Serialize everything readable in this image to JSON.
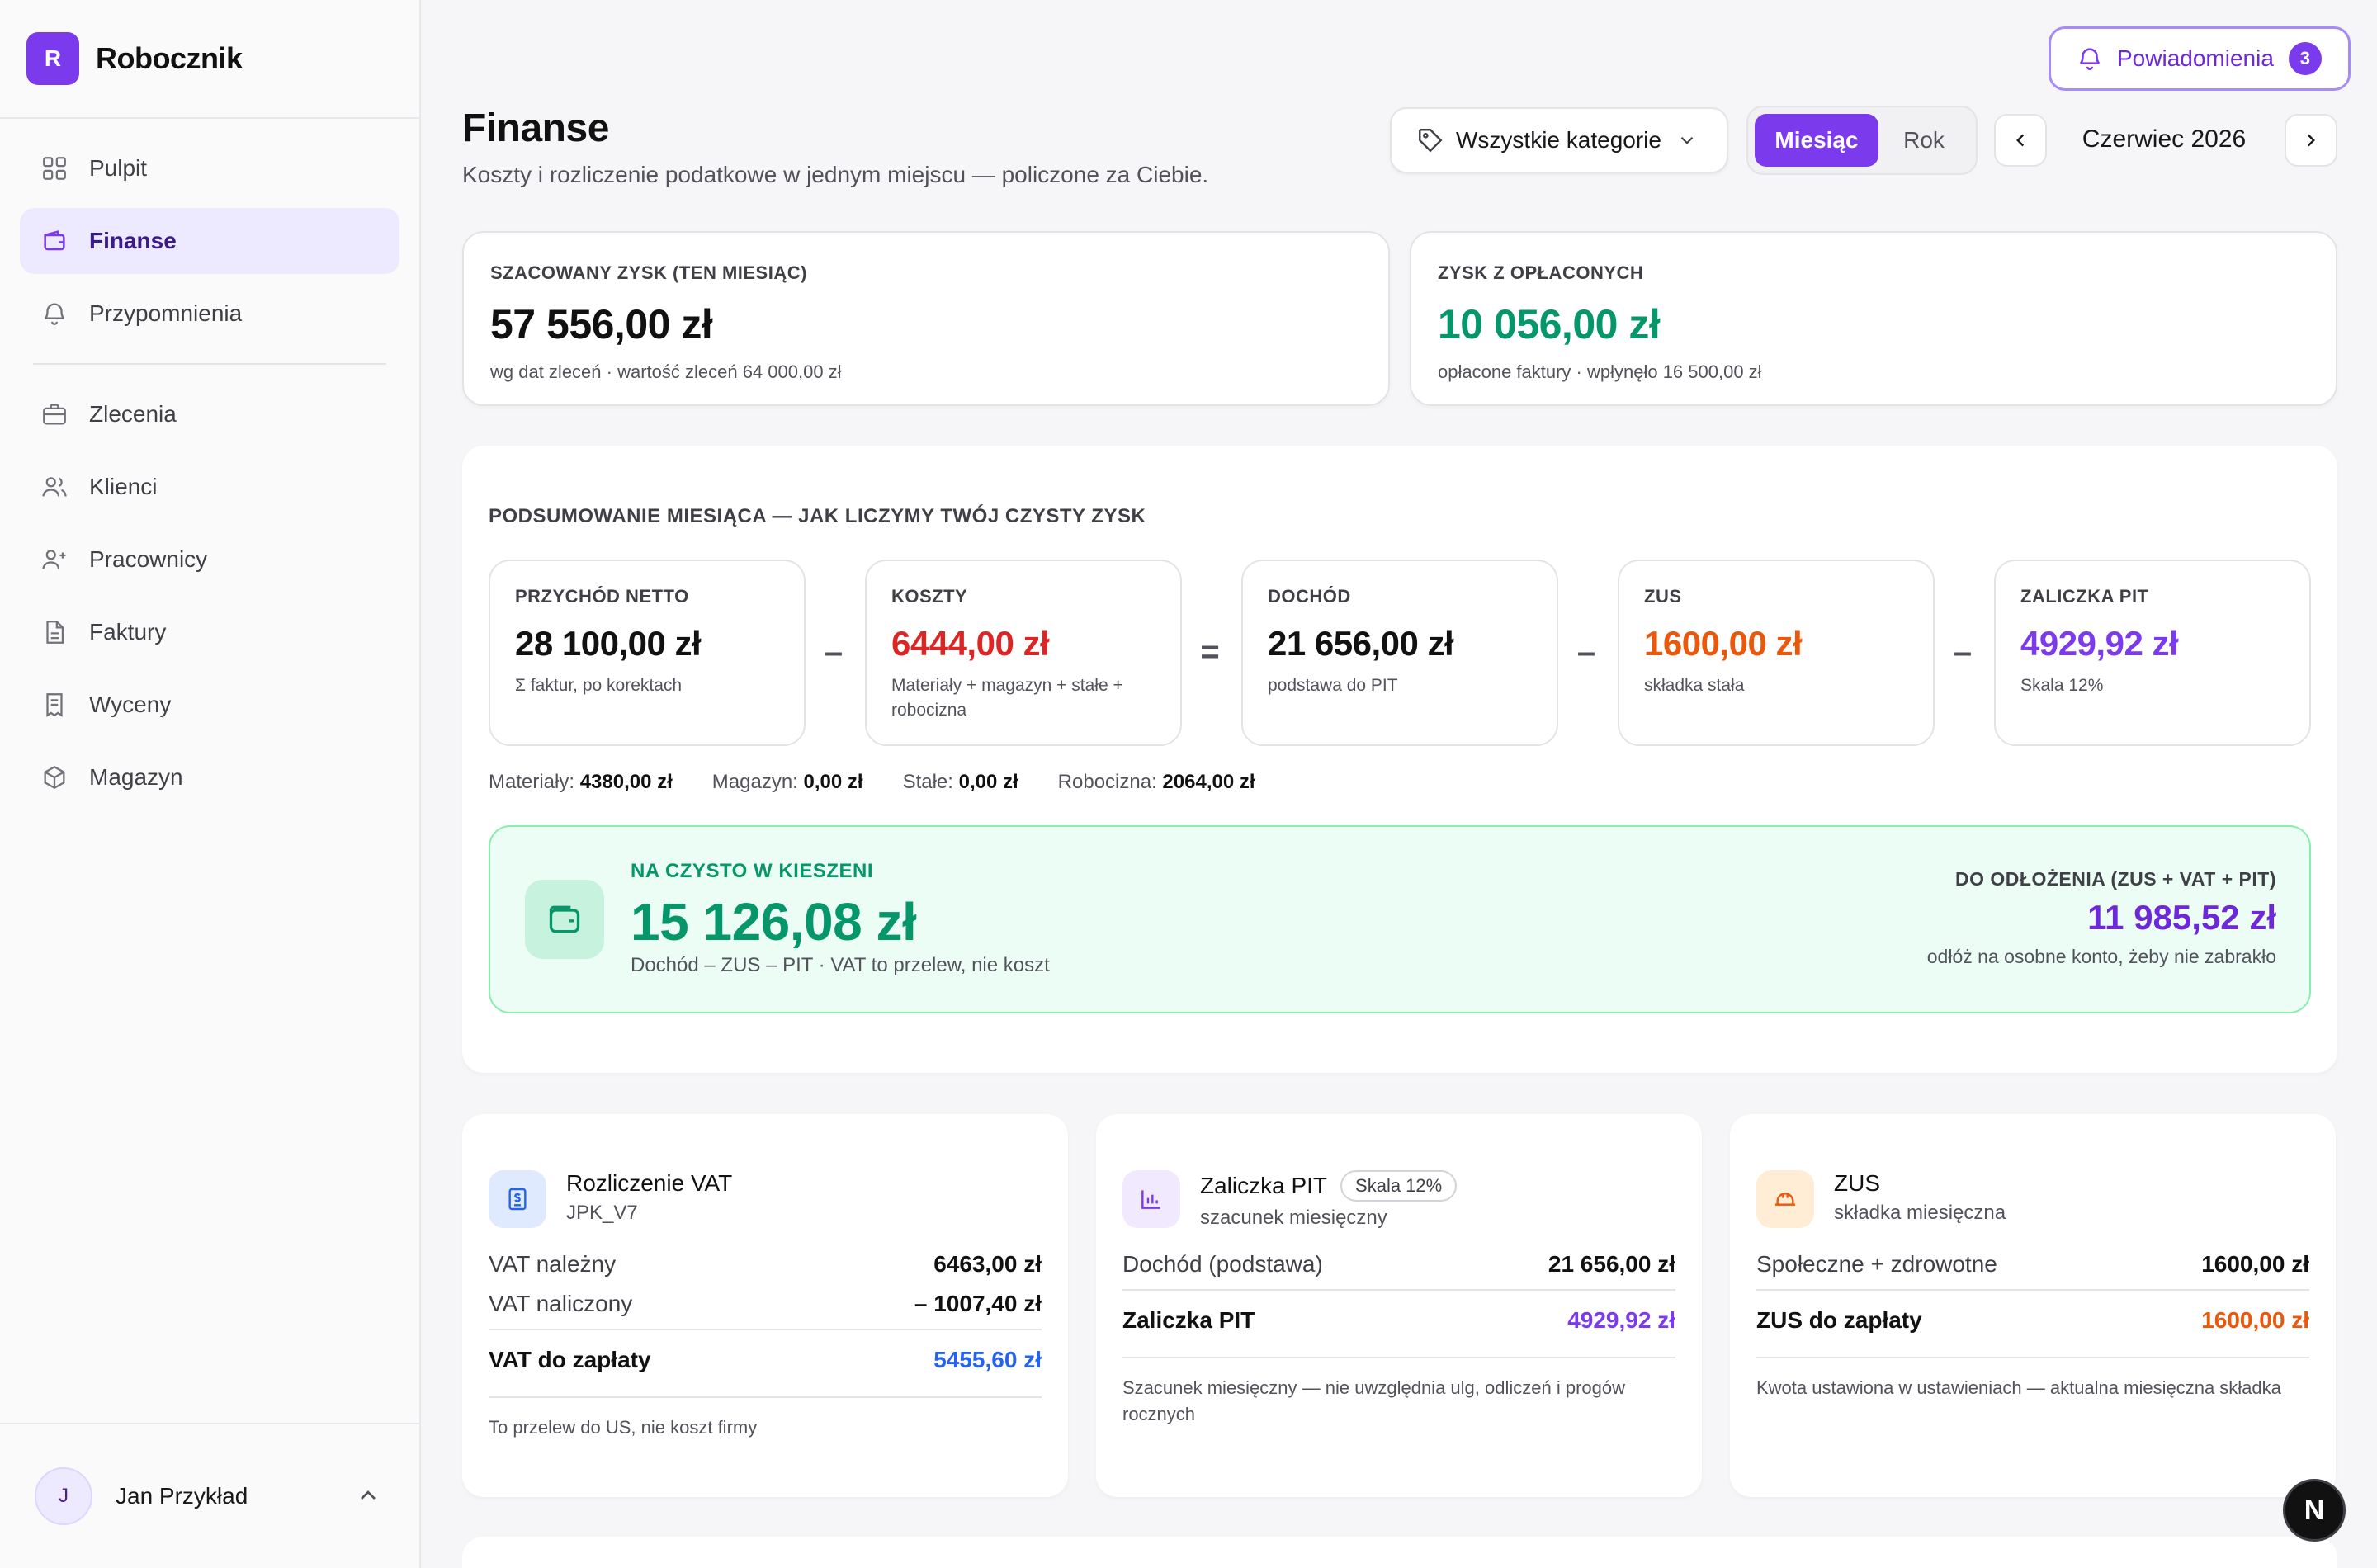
{
  "brand": {
    "logo_letter": "R",
    "name": "Robocznik"
  },
  "sidebar": {
    "items": [
      {
        "label": "Pulpit",
        "icon": "grid-icon"
      },
      {
        "label": "Finanse",
        "icon": "wallet-icon",
        "active": true
      },
      {
        "label": "Przypomnienia",
        "icon": "bell-icon"
      },
      {
        "label": "Zlecenia",
        "icon": "briefcase-icon"
      },
      {
        "label": "Klienci",
        "icon": "users-icon"
      },
      {
        "label": "Pracownicy",
        "icon": "user-plus-icon"
      },
      {
        "label": "Faktury",
        "icon": "document-icon"
      },
      {
        "label": "Wyceny",
        "icon": "receipt-icon"
      },
      {
        "label": "Magazyn",
        "icon": "box-icon"
      }
    ]
  },
  "user": {
    "initial": "J",
    "name": "Jan Przykład"
  },
  "notifications": {
    "label": "Powiadomienia",
    "count": "3"
  },
  "header": {
    "title": "Finanse",
    "subtitle": "Koszty i rozliczenie podatkowe w jednym miejscu — policzone za Ciebie.",
    "category_select": "Wszystkie kategorie",
    "period_toggle": {
      "month": "Miesiąc",
      "year": "Rok",
      "selected": "Miesiąc"
    },
    "period": "Czerwiec 2026"
  },
  "stats": {
    "estimated": {
      "caption": "SZACOWANY ZYSK (TEN MIESIĄC)",
      "value": "57 556,00 zł",
      "note": "wg dat zleceń · wartość zleceń 64 000,00 zł"
    },
    "paid": {
      "caption": "ZYSK Z OPŁACONYCH",
      "value": "10 056,00 zł",
      "note": "opłacone faktury · wpłynęło 16 500,00 zł"
    }
  },
  "summary": {
    "title": "PODSUMOWANIE MIESIĄCA — JAK LICZYMY TWÓJ CZYSTY ZYSK",
    "boxes": [
      {
        "caption": "PRZYCHÓD NETTO",
        "value": "28 100,00 zł",
        "note": "Σ faktur, po korektach",
        "color": "#111111"
      },
      {
        "caption": "KOSZTY",
        "value": "6444,00 zł",
        "note": "Materiały + magazyn + stałe + robocizna",
        "color": "#dc2626"
      },
      {
        "caption": "DOCHÓD",
        "value": "21 656,00 zł",
        "note": "podstawa do PIT",
        "color": "#111111"
      },
      {
        "caption": "ZUS",
        "value": "1600,00 zł",
        "note": "składka stała",
        "color": "#ea580c"
      },
      {
        "caption": "ZALICZKA PIT",
        "value": "4929,92 zł",
        "note": "Skala 12%",
        "color": "#7c3aed"
      }
    ],
    "operators": [
      "–",
      "=",
      "–",
      "–"
    ],
    "breakdown": [
      {
        "label": "Materiały:",
        "value": "4380,00 zł"
      },
      {
        "label": "Magazyn:",
        "value": "0,00 zł"
      },
      {
        "label": "Stałe:",
        "value": "0,00 zł"
      },
      {
        "label": "Robocizna:",
        "value": "2064,00 zł"
      }
    ],
    "net": {
      "caption": "NA CZYSTO W KIESZENI",
      "value": "15 126,08 zł",
      "note": "Dochód – ZUS – PIT · VAT to przelew, nie koszt",
      "set_aside_caption": "DO ODŁOŻENIA (ZUS + VAT + PIT)",
      "set_aside_value": "11 985,52 zł",
      "set_aside_note": "odłóż na osobne konto, żeby nie zabrakło"
    }
  },
  "vat": {
    "title": "Rozliczenie VAT",
    "subtitle": "JPK_V7",
    "rows": [
      {
        "label": "VAT należny",
        "value": "6463,00 zł"
      },
      {
        "label": "VAT naliczony",
        "value": "– 1007,40 zł"
      }
    ],
    "total_label": "VAT do zapłaty",
    "total_value": "5455,60 zł",
    "total_color": "#2563eb",
    "footer": "To przelew do US, nie koszt firmy"
  },
  "pit": {
    "title": "Zaliczka PIT",
    "chip": "Skala 12%",
    "subtitle": "szacunek miesięczny",
    "rows": [
      {
        "label": "Dochód (podstawa)",
        "value": "21 656,00 zł"
      }
    ],
    "total_label": "Zaliczka PIT",
    "total_value": "4929,92 zł",
    "total_color": "#7c3aed",
    "footer": "Szacunek miesięczny — nie uwzględnia ulg, odliczeń i progów rocznych"
  },
  "zus": {
    "title": "ZUS",
    "subtitle": "składka miesięczna",
    "rows": [
      {
        "label": "Społeczne + zdrowotne",
        "value": "1600,00 zł"
      }
    ],
    "total_label": "ZUS do zapłaty",
    "total_value": "1600,00 zł",
    "total_color": "#ea580c",
    "footer": "Kwota ustawiona w ustawieniach — aktualna miesięczna składka"
  },
  "dev_badge": "N",
  "colors": {
    "accent": "#7c3aed",
    "green": "#059669",
    "red": "#dc2626",
    "orange": "#ea580c",
    "blue": "#2563eb"
  }
}
